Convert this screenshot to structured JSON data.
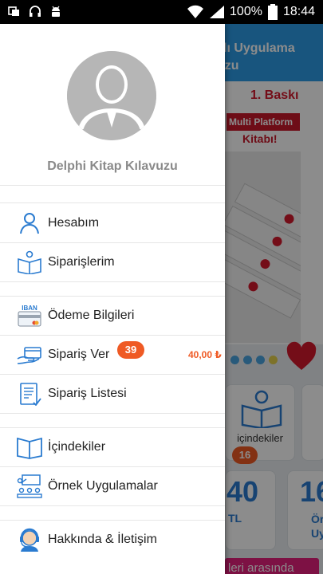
{
  "status_bar": {
    "battery": "100%",
    "time": "18:44"
  },
  "background_app": {
    "header_title": "zlı Uygulama\nuzu",
    "banner": {
      "edition": "1. Baskı",
      "tag1": "Multi Platform",
      "tag2": "Kitabı!"
    },
    "toc_card": {
      "label": "içindekiler",
      "badge": "16"
    },
    "price_card_1": {
      "value": "40",
      "unit": "TL"
    },
    "price_card_2": {
      "value": "16",
      "unit": "Ör\nUyg"
    },
    "pink_bar_text": "leri arasında"
  },
  "drawer": {
    "profile_name": "Delphi Kitap Kılavuzu",
    "items": [
      {
        "label": "Hesabım",
        "icon": "user-icon"
      },
      {
        "label": "Siparişlerim",
        "icon": "open-book-reader-icon"
      },
      {
        "label": "Ödeme Bilgileri",
        "icon": "iban-card-icon",
        "icon_text": "IBAN"
      },
      {
        "label": "Sipariş Ver",
        "icon": "card-payment-icon",
        "badge": "39",
        "price": "40,00 ₺"
      },
      {
        "label": "Sipariş Listesi",
        "icon": "order-list-icon"
      },
      {
        "label": "İçindekiler",
        "icon": "book-icon"
      },
      {
        "label": "Örnek Uygulamalar",
        "icon": "classroom-icon"
      },
      {
        "label": "Hakkında & İletişim",
        "icon": "support-agent-icon"
      }
    ]
  },
  "colors": {
    "accent_blue": "#2d9be5",
    "badge_orange": "#ef5a24",
    "pink": "#e3207c",
    "heart_red": "#d3192d"
  }
}
